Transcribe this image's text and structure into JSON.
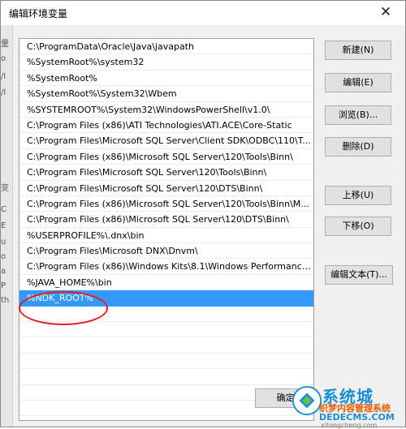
{
  "window": {
    "title": "编辑环境变量",
    "close_glyph": "✕"
  },
  "left_strip": [
    "量",
    "o",
    "/l",
    "/l",
    "变",
    "C",
    "E",
    "u",
    "o",
    "a",
    "P",
    "th"
  ],
  "list": {
    "selected_index": 16,
    "items": [
      "C:\\ProgramData\\Oracle\\Java\\javapath",
      "%SystemRoot%\\system32",
      "%SystemRoot%",
      "%SystemRoot%\\System32\\Wbem",
      "%SYSTEMROOT%\\System32\\WindowsPowerShell\\v1.0\\",
      "C:\\Program Files (x86)\\ATI Technologies\\ATI.ACE\\Core-Static",
      "C:\\Program Files\\Microsoft SQL Server\\Client SDK\\ODBC\\110\\T...",
      "C:\\Program Files (x86)\\Microsoft SQL Server\\120\\Tools\\Binn\\",
      "C:\\Program Files\\Microsoft SQL Server\\120\\Tools\\Binn\\",
      "C:\\Program Files\\Microsoft SQL Server\\120\\DTS\\Binn\\",
      "C:\\Program Files (x86)\\Microsoft SQL Server\\120\\Tools\\Binn\\M...",
      "C:\\Program Files (x86)\\Microsoft SQL Server\\120\\DTS\\Binn\\",
      "%USERPROFILE%\\.dnx\\bin",
      "C:\\Program Files\\Microsoft DNX\\Dnvm\\",
      "C:\\Program Files (x86)\\Windows Kits\\8.1\\Windows Performance...",
      "%JAVA_HOME%\\bin",
      "%NDK_ROOT%"
    ]
  },
  "buttons": {
    "new": "新建(N)",
    "edit": "编辑(E)",
    "browse": "浏览(B)...",
    "delete": "删除(D)",
    "move_up": "上移(U)",
    "move_down": "下移(O)",
    "edit_text": "编辑文本(T)...",
    "ok": "确定"
  },
  "watermark": {
    "brand": "系统城",
    "subtitle": "织梦内容管理系统",
    "domain": "DEDECMS.COM",
    "url": "xitongcheng.com"
  },
  "colors": {
    "selection": "#3399ff",
    "annotation": "#e02020"
  }
}
